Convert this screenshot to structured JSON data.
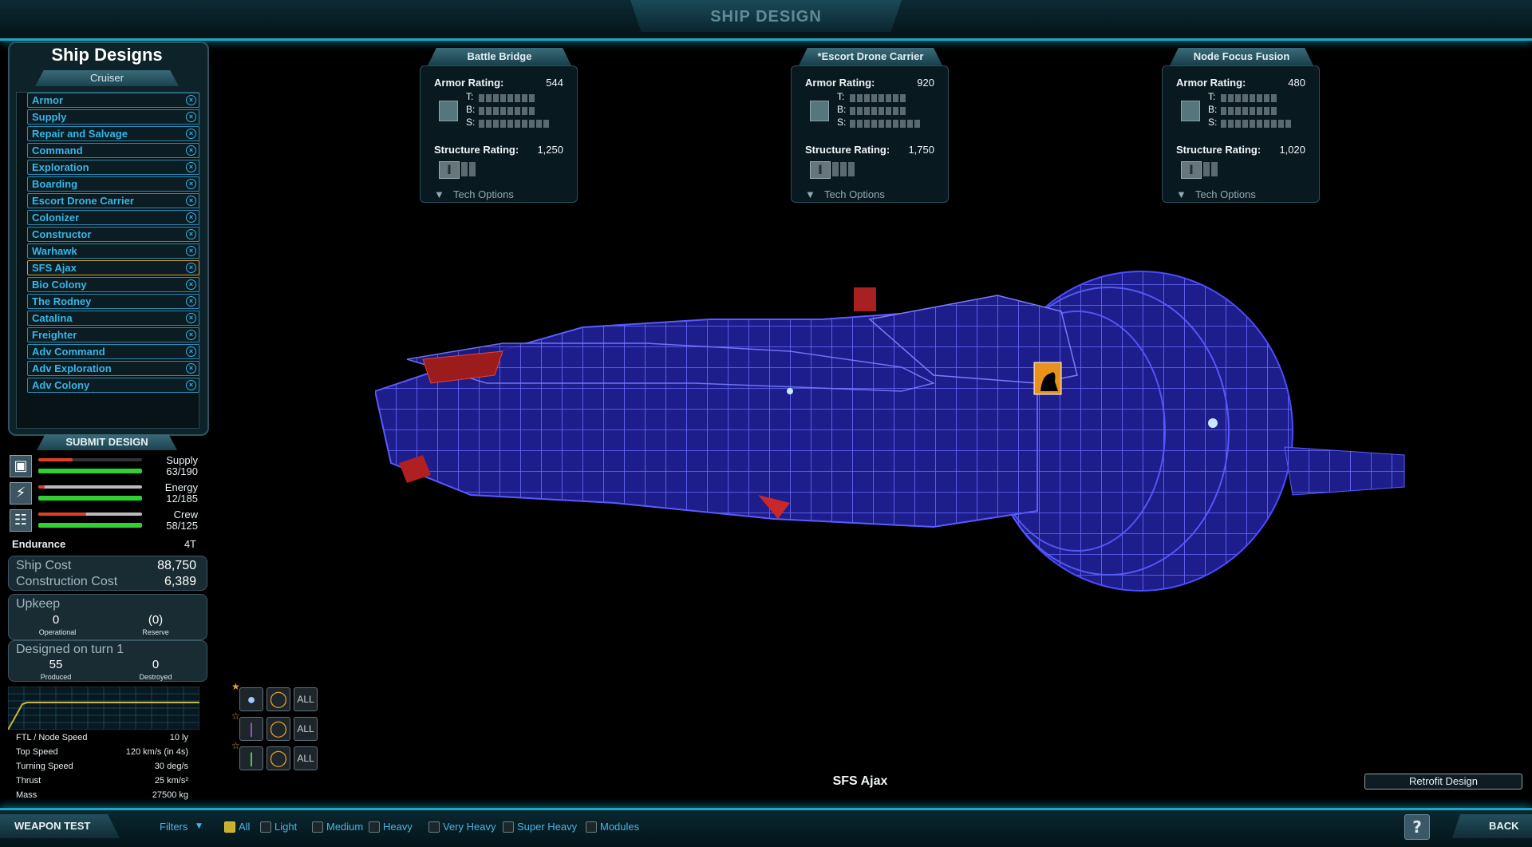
{
  "header": {
    "title": "SHIP DESIGN"
  },
  "designs_panel": {
    "title": "Ship Designs",
    "class_tab": "Cruiser",
    "items": [
      {
        "label": "Armor"
      },
      {
        "label": "Supply"
      },
      {
        "label": "Repair and Salvage"
      },
      {
        "label": "Command"
      },
      {
        "label": "Exploration"
      },
      {
        "label": "Boarding"
      },
      {
        "label": "Escort Drone Carrier"
      },
      {
        "label": "Colonizer"
      },
      {
        "label": "Constructor"
      },
      {
        "label": "Warhawk"
      },
      {
        "label": "SFS Ajax",
        "selected": true
      },
      {
        "label": "Bio Colony"
      },
      {
        "label": "The Rodney"
      },
      {
        "label": "Catalina"
      },
      {
        "label": "Freighter"
      },
      {
        "label": "Adv Command"
      },
      {
        "label": "Adv Exploration"
      },
      {
        "label": "Adv Colony"
      }
    ],
    "submit_label": "SUBMIT DESIGN"
  },
  "resources": {
    "supply": {
      "label": "Supply",
      "value": "63/190",
      "fill": 0.33
    },
    "energy": {
      "label": "Energy",
      "value": "12/185",
      "fill": 0.06
    },
    "crew": {
      "label": "Crew",
      "value": "58/125",
      "fill": 0.46
    }
  },
  "endurance": {
    "label": "Endurance",
    "value": "4T"
  },
  "costs": {
    "ship_cost_label": "Ship Cost",
    "ship_cost": "88,750",
    "construction_label": "Construction Cost",
    "construction": "6,389"
  },
  "upkeep": {
    "label": "Upkeep",
    "operational": "0",
    "operational_label": "Operational",
    "reserve": "(0)",
    "reserve_label": "Reserve"
  },
  "history": {
    "designed": "Designed on turn 1",
    "produced": "55",
    "produced_label": "Produced",
    "destroyed": "0",
    "destroyed_label": "Destroyed"
  },
  "specs": [
    {
      "label": "FTL / Node Speed",
      "value": "10 ly"
    },
    {
      "label": "Top Speed",
      "value": "120 km/s (in 4s)"
    },
    {
      "label": "Turning Speed",
      "value": "30 deg/s"
    },
    {
      "label": "Thrust",
      "value": "25 km/s²"
    },
    {
      "label": "Mass",
      "value": "27500 kg"
    }
  ],
  "cards": [
    {
      "title": "Battle Bridge",
      "armor_label": "Armor Rating:",
      "armor": "544",
      "structure_label": "Structure Rating:",
      "structure": "1,250",
      "tech_label": "Tech Options"
    },
    {
      "title": "*Escort Drone Carrier",
      "armor_label": "Armor Rating:",
      "armor": "920",
      "structure_label": "Structure Rating:",
      "structure": "1,750",
      "tech_label": "Tech Options"
    },
    {
      "title": "Node Focus Fusion",
      "armor_label": "Armor Rating:",
      "armor": "480",
      "structure_label": "Structure Rating:",
      "structure": "1,020",
      "tech_label": "Tech Options"
    }
  ],
  "armor_rows": {
    "t": "T:",
    "b": "B:",
    "s": "S:"
  },
  "weapon_filters": {
    "all_label": "ALL"
  },
  "ship_name": "SFS Ajax",
  "retrofit_label": "Retrofit Design",
  "bottom": {
    "weapon_test": "WEAPON TEST",
    "filters": "Filters",
    "options": [
      "All",
      "Light",
      "Medium",
      "Heavy",
      "Very Heavy",
      "Super Heavy",
      "Modules"
    ],
    "help": "?",
    "back": "BACK"
  },
  "colors": {
    "accent": "#1fa6c4",
    "list_text": "#36b6e6",
    "selected": "#e0a030",
    "bar_green": "#2fd02f",
    "bar_red": "#e0402a"
  }
}
